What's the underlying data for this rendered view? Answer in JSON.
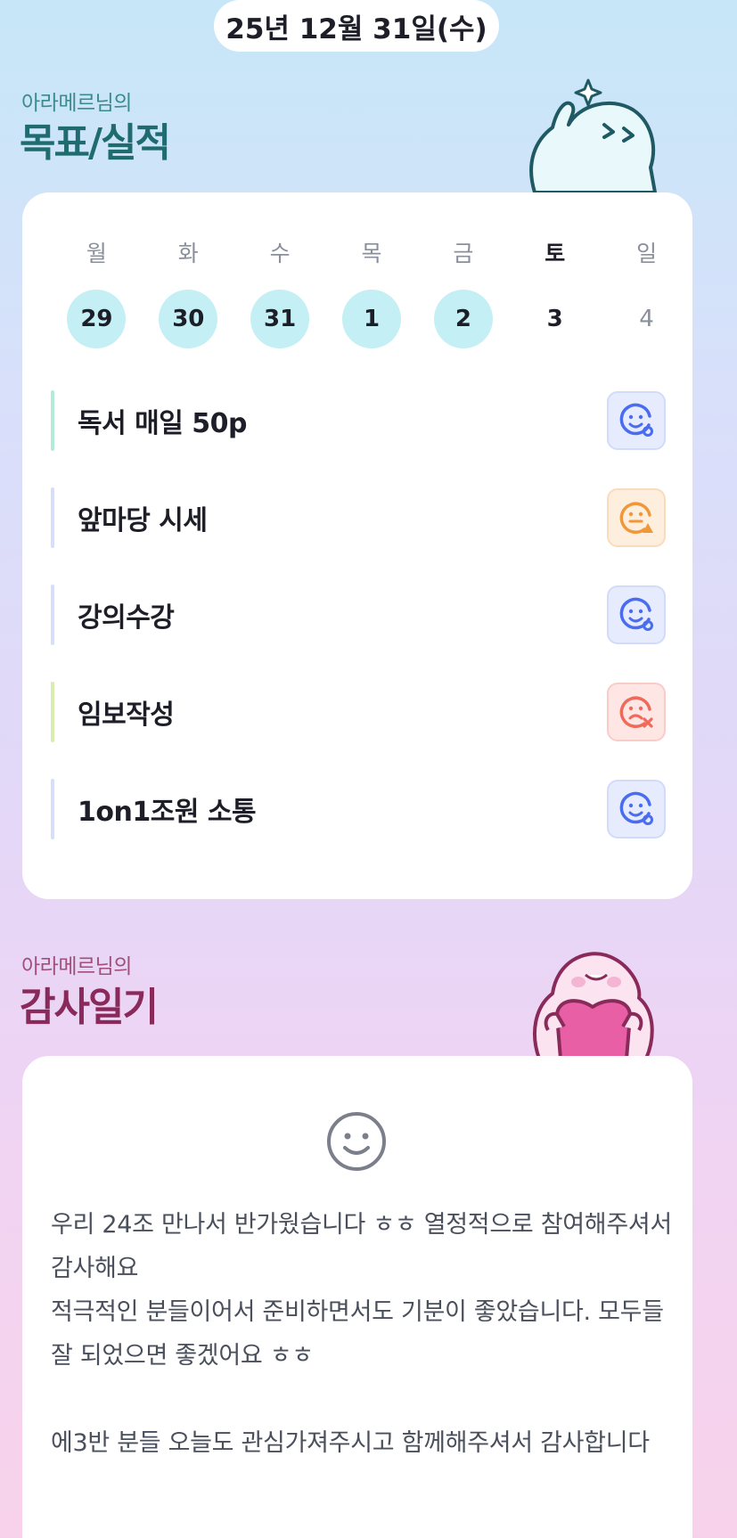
{
  "date": "25년 12월 31일(수)",
  "goals_section": {
    "subtitle": "아라메르님의",
    "title": "목표/실적"
  },
  "week": [
    {
      "name": "월",
      "num": "29",
      "state": "done"
    },
    {
      "name": "화",
      "num": "30",
      "state": "done"
    },
    {
      "name": "수",
      "num": "31",
      "state": "done"
    },
    {
      "name": "목",
      "num": "1",
      "state": "done"
    },
    {
      "name": "금",
      "num": "2",
      "state": "done"
    },
    {
      "name": "토",
      "num": "3",
      "state": "today"
    },
    {
      "name": "일",
      "num": "4",
      "state": "future"
    }
  ],
  "goals": [
    {
      "label": "독서 매일 50p",
      "status": "good",
      "bar_color": "#b6ead8",
      "icon": "smile-check-icon"
    },
    {
      "label": "앞마당 시세",
      "status": "warn",
      "bar_color": "#d6defa",
      "icon": "smile-warning-icon"
    },
    {
      "label": "강의수강",
      "status": "good",
      "bar_color": "#d6defa",
      "icon": "smile-check-icon"
    },
    {
      "label": "임보작성",
      "status": "bad",
      "bar_color": "#d8eeb0",
      "icon": "frown-x-icon"
    },
    {
      "label": "1on1조원 소통",
      "status": "good",
      "bar_color": "#d6defa",
      "icon": "smile-check-icon"
    }
  ],
  "gratitude_section": {
    "subtitle": "아라메르님의",
    "title": "감사일기",
    "mood_icon": "smile-face-icon",
    "text": "우리 24조 만나서 반가웠습니다 ㅎㅎ 열정적으로 참여해주셔서 감사해요\n적극적인 분들이어서 준비하면서도 기분이 좋았습니다. 모두들 잘 되었으면 좋겠어요 ㅎㅎ\n\n에3반 분들 오늘도 관심가져주시고 함께해주셔서 감사합니다"
  },
  "colors": {
    "good": "#4a6cf0",
    "warn": "#f0973a",
    "bad": "#f06a5a",
    "done_circle": "#c4eff4"
  }
}
